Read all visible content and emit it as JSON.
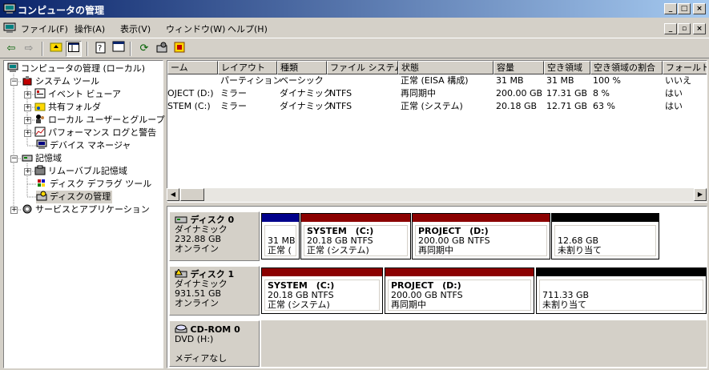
{
  "window": {
    "title": "コンピュータの管理"
  },
  "menu": {
    "items": [
      "ファイル(F)",
      "操作(A)",
      "表示(V)",
      "ウィンドウ(W)",
      "ヘルプ(H)"
    ]
  },
  "tree": {
    "items": [
      {
        "label": "コンピュータの管理 (ローカル)",
        "icon": "computer-icon"
      },
      {
        "label": "システム ツール",
        "icon": "tools-icon"
      },
      {
        "label": "イベント ビューア",
        "icon": "event-viewer-icon"
      },
      {
        "label": "共有フォルダ",
        "icon": "shared-folder-icon"
      },
      {
        "label": "ローカル ユーザーとグループ",
        "icon": "users-icon"
      },
      {
        "label": "パフォーマンス ログと警告",
        "icon": "performance-icon"
      },
      {
        "label": "デバイス マネージャ",
        "icon": "device-manager-icon"
      },
      {
        "label": "記憶域",
        "icon": "storage-icon"
      },
      {
        "label": "リムーバブル記憶域",
        "icon": "removable-storage-icon"
      },
      {
        "label": "ディスク デフラグ ツール",
        "icon": "defrag-icon"
      },
      {
        "label": "ディスクの管理",
        "icon": "disk-management-icon"
      },
      {
        "label": "サービスとアプリケーション",
        "icon": "services-icon"
      }
    ]
  },
  "list": {
    "columns": [
      "ーム",
      "レイアウト",
      "種類",
      "ファイル システム",
      "状態",
      "容量",
      "空き領域",
      "空き領域の割合",
      "フォールト"
    ],
    "rows": [
      [
        "",
        "パーティション",
        "ベーシック",
        "",
        "正常 (EISA 構成)",
        "31 MB",
        "31 MB",
        "100 %",
        "いいえ"
      ],
      [
        "OJECT (D:)",
        "ミラー",
        "ダイナミック",
        "NTFS",
        "再同期中",
        "200.00 GB",
        "17.31 GB",
        "8 %",
        "はい"
      ],
      [
        "STEM (C:)",
        "ミラー",
        "ダイナミック",
        "NTFS",
        "正常 (システム)",
        "20.18 GB",
        "12.71 GB",
        "63 %",
        "はい"
      ]
    ]
  },
  "disks": [
    {
      "name": "ディスク 0",
      "type": "ダイナミック",
      "size": "232.88 GB",
      "status": "オンライン",
      "partitions": [
        {
          "title": "",
          "line1": "31 MB",
          "line2": "正常 (",
          "color": "#00008b"
        },
        {
          "title": "SYSTEM　(C:)",
          "line1": "20.18 GB NTFS",
          "line2": "正常 (システム)",
          "color": "#8b0000"
        },
        {
          "title": "PROJECT　(D:)",
          "line1": "200.00 GB NTFS",
          "line2": "再同期中",
          "color": "#8b0000"
        },
        {
          "title": "",
          "line1": "12.68 GB",
          "line2": "未割り当て",
          "color": "#000000"
        }
      ]
    },
    {
      "name": "ディスク 1",
      "type": "ダイナミック",
      "size": "931.51 GB",
      "status": "オンライン",
      "partitions": [
        {
          "title": "SYSTEM　(C:)",
          "line1": "20.18 GB NTFS",
          "line2": "正常 (システム)",
          "color": "#8b0000"
        },
        {
          "title": "PROJECT　(D:)",
          "line1": "200.00 GB NTFS",
          "line2": "再同期中",
          "color": "#8b0000"
        },
        {
          "title": "",
          "line1": "711.33 GB",
          "line2": "未割り当て",
          "color": "#000000"
        }
      ]
    },
    {
      "name": "CD-ROM 0",
      "type": "DVD (H:)",
      "size": "",
      "status": "メディアなし",
      "partitions": []
    }
  ]
}
